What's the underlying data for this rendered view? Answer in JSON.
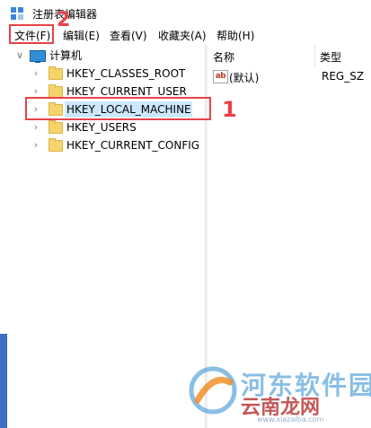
{
  "window": {
    "title": "注册表编辑器"
  },
  "menubar": {
    "items": [
      "文件(F)",
      "编辑(E)",
      "查看(V)",
      "收藏夹(A)",
      "帮助(H)"
    ]
  },
  "tree": {
    "root": "计算机",
    "keys": [
      "HKEY_CLASSES_ROOT",
      "HKEY_CURRENT_USER",
      "HKEY_LOCAL_MACHINE",
      "HKEY_USERS",
      "HKEY_CURRENT_CONFIG"
    ],
    "selected_index": 2
  },
  "values_pane": {
    "columns": {
      "name": "名称",
      "type": "类型"
    },
    "rows": [
      {
        "icon_text": "ab",
        "name": "(默认)",
        "type": "REG_SZ"
      }
    ]
  },
  "annotations": {
    "num1": "1",
    "num2": "2"
  },
  "watermark": {
    "line1": "河东软件园",
    "line2": "云南龙网",
    "url": "www.xiazaiba.com"
  },
  "colors": {
    "annotation": "#e8424a",
    "selection": "#cce8ff",
    "accent": "#2e8fd8"
  }
}
